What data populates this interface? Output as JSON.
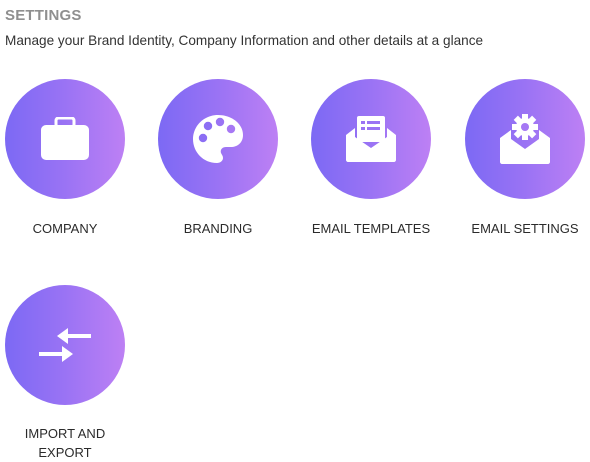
{
  "header": {
    "title": "SETTINGS",
    "subtitle": "Manage your Brand Identity, Company Information and other details at a glance"
  },
  "colors": {
    "gradient_start": "#7c69f4",
    "gradient_end": "#bd80f4",
    "title_color": "#8f8f8f"
  },
  "tiles": [
    {
      "label": "COMPANY",
      "icon": "briefcase-icon"
    },
    {
      "label": "BRANDING",
      "icon": "palette-icon"
    },
    {
      "label": "EMAIL TEMPLATES",
      "icon": "open-envelope-template-icon"
    },
    {
      "label": "EMAIL SETTINGS",
      "icon": "open-envelope-gear-icon"
    },
    {
      "label": "IMPORT AND EXPORT",
      "icon": "import-export-arrows-icon"
    }
  ]
}
